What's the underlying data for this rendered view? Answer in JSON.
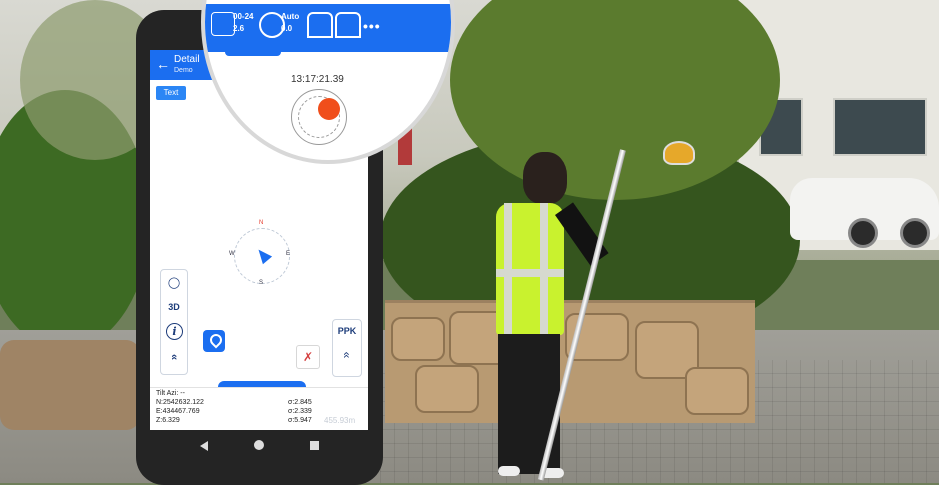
{
  "status_bar": {
    "satellite": {
      "line1": "00-24",
      "line2": "2.6"
    },
    "mode": {
      "line1": "Auto",
      "line2": "0.0"
    },
    "more_label": "•••"
  },
  "header": {
    "title": "Detail",
    "subtitle": "Demo"
  },
  "text_button": "Text",
  "clock": "13:17:21.39",
  "compass": {
    "n": "N",
    "e": "E",
    "s": "S",
    "w": "W"
  },
  "tools": {
    "three_d": "3D",
    "info": "i",
    "chevron": "«",
    "ppk": "PPK",
    "ppk_chevron": "«"
  },
  "info_panel": {
    "tilt": "Tilt Azi: --",
    "n": "N:2542632.122",
    "e": "E:434467.769",
    "z": "Z:6.329",
    "sigma_n": "σ:2.845",
    "sigma_e": "σ:2.339",
    "sigma_z": "σ:5.947",
    "distance": "455.93m"
  },
  "colors": {
    "primary": "#1b6ef0",
    "accent": "#f04e1b",
    "vest": "#c9f22e"
  },
  "icons": [
    "back-arrow-icon",
    "satellite-icon",
    "target-icon",
    "antenna-icon",
    "more-icon",
    "locate-pin-icon",
    "erase-icon",
    "chevron-up-icon"
  ]
}
